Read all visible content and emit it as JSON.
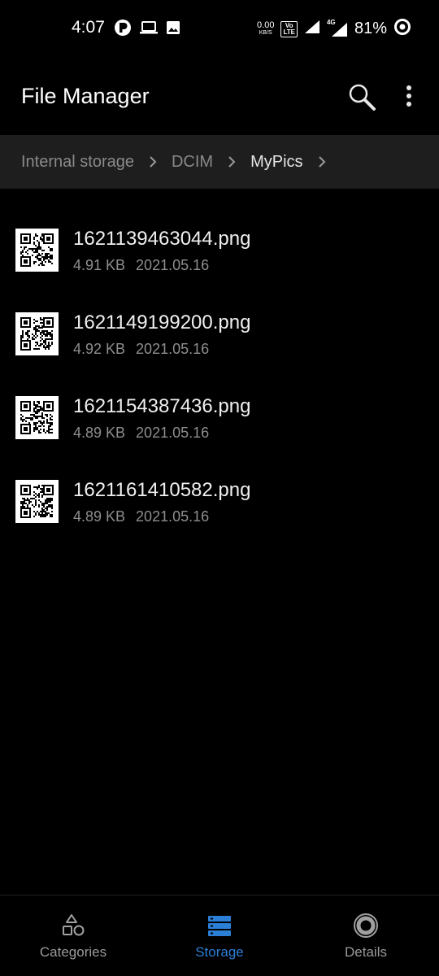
{
  "status_bar": {
    "time": "4:07",
    "speed_value": "0.00",
    "speed_unit": "KB/S",
    "volte_top": "Vo",
    "volte_bottom": "LTE",
    "network_type": "4G",
    "battery": "81%",
    "left_icons": [
      "app-notification-icon",
      "laptop-icon",
      "image-icon"
    ],
    "right_icons": [
      "wifi-signal-icon",
      "cell-signal-icon",
      "battery-ring-icon"
    ]
  },
  "app_bar": {
    "title": "File Manager",
    "icons": [
      "search-icon",
      "more-vertical-icon"
    ]
  },
  "breadcrumb": [
    {
      "label": "Internal storage"
    },
    {
      "label": "DCIM"
    },
    {
      "label": "MyPics"
    }
  ],
  "files": [
    {
      "name": "1621139463044.png",
      "size": "4.91 KB",
      "date": "2021.05.16"
    },
    {
      "name": "1621149199200.png",
      "size": "4.92 KB",
      "date": "2021.05.16"
    },
    {
      "name": "1621154387436.png",
      "size": "4.89 KB",
      "date": "2021.05.16"
    },
    {
      "name": "1621161410582.png",
      "size": "4.89 KB",
      "date": "2021.05.16"
    }
  ],
  "bottom_nav": [
    {
      "label": "Categories",
      "icon": "categories-icon",
      "active": false
    },
    {
      "label": "Storage",
      "icon": "storage-icon",
      "active": true
    },
    {
      "label": "Details",
      "icon": "details-icon",
      "active": false
    }
  ],
  "colors": {
    "background": "#000000",
    "breadcrumb_bg": "#1e1e1e",
    "accent": "#2c7fd6",
    "secondary_text": "#8e8e8e"
  }
}
